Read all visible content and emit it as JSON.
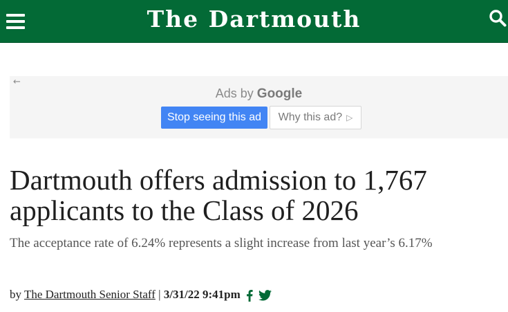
{
  "header": {
    "title": "The Dartmouth",
    "brand_color": "#036a36",
    "icons": [
      "menu-icon",
      "search-icon"
    ]
  },
  "ad": {
    "back_symbol": "←",
    "ads_by_prefix": "Ads by",
    "ads_by_brand": "Google",
    "stop_label": "Stop seeing this ad",
    "why_label": "Why this ad?",
    "why_symbol": "▷",
    "accent": "#4285f4"
  },
  "article": {
    "headline": "Dartmouth offers admission to 1,767 applicants to the Class of 2026",
    "subhead": "The acceptance rate of 6.24% represents a slight increase from last year’s 6.17%",
    "byline": {
      "prefix": "by",
      "author": "The Dartmouth Senior Staff",
      "separator": "|",
      "date": "3/31/22 9:41pm",
      "share_icons": [
        "facebook-icon",
        "twitter-icon"
      ],
      "share_color": "#036a36"
    }
  }
}
